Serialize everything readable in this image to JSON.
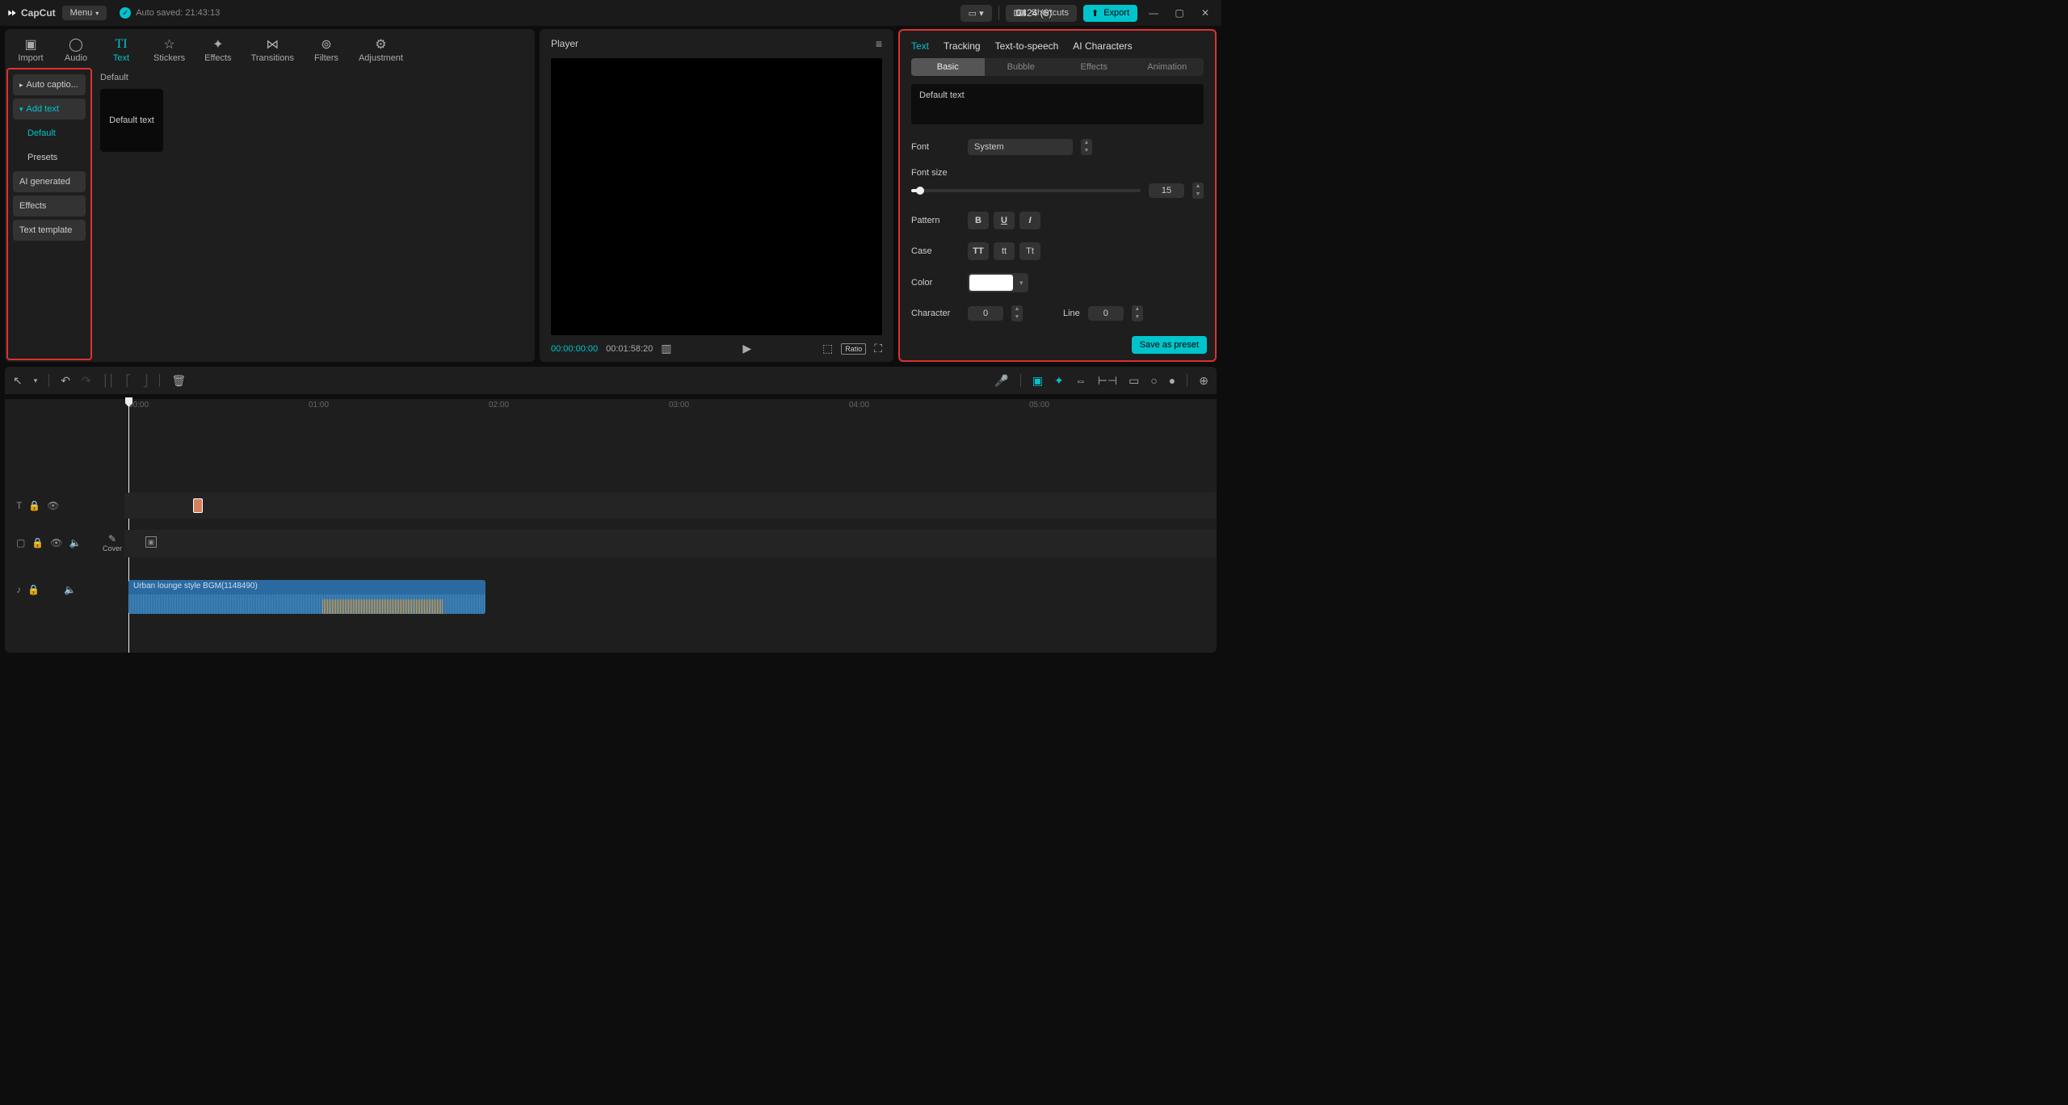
{
  "titlebar": {
    "app_name": "CapCut",
    "menu_label": "Menu",
    "autosave_text": "Auto saved: 21:43:13",
    "project_title": "0424 (6)",
    "shortcuts_label": "Shortcuts",
    "export_label": "Export"
  },
  "top_tabs": {
    "import": "Import",
    "audio": "Audio",
    "text": "Text",
    "stickers": "Stickers",
    "effects": "Effects",
    "transitions": "Transitions",
    "filters": "Filters",
    "adjustment": "Adjustment"
  },
  "side_list": {
    "auto_captions": "Auto captio...",
    "add_text": "Add text",
    "default": "Default",
    "presets": "Presets",
    "ai_generated": "AI generated",
    "effects": "Effects",
    "text_template": "Text template"
  },
  "grid": {
    "section_title": "Default",
    "thumb_label": "Default text"
  },
  "player": {
    "title": "Player",
    "current_time": "00:00:00:00",
    "duration": "00:01:58:20",
    "ratio_label": "Ratio"
  },
  "inspector": {
    "tabs": {
      "text": "Text",
      "tracking": "Tracking",
      "tts": "Text-to-speech",
      "ai_chars": "AI Characters"
    },
    "subtabs": {
      "basic": "Basic",
      "bubble": "Bubble",
      "effects": "Effects",
      "animation": "Animation"
    },
    "text_content": "Default text",
    "labels": {
      "font": "Font",
      "font_size": "Font size",
      "pattern": "Pattern",
      "case": "Case",
      "color": "Color",
      "character": "Character",
      "line": "Line"
    },
    "font_value": "System",
    "font_size_value": "15",
    "character_value": "0",
    "line_value": "0",
    "pattern_b": "B",
    "pattern_u": "U",
    "pattern_i": "I",
    "case_upper": "TT",
    "case_lower": "tt",
    "case_title": "Tt",
    "save_preset_label": "Save as preset"
  },
  "timeline": {
    "ruler_ticks": [
      "00:00",
      "01:00",
      "02:00",
      "03:00",
      "04:00",
      "05:00"
    ],
    "cover_label": "Cover",
    "audio_clip_label": "Urban lounge style BGM(1148490)"
  }
}
